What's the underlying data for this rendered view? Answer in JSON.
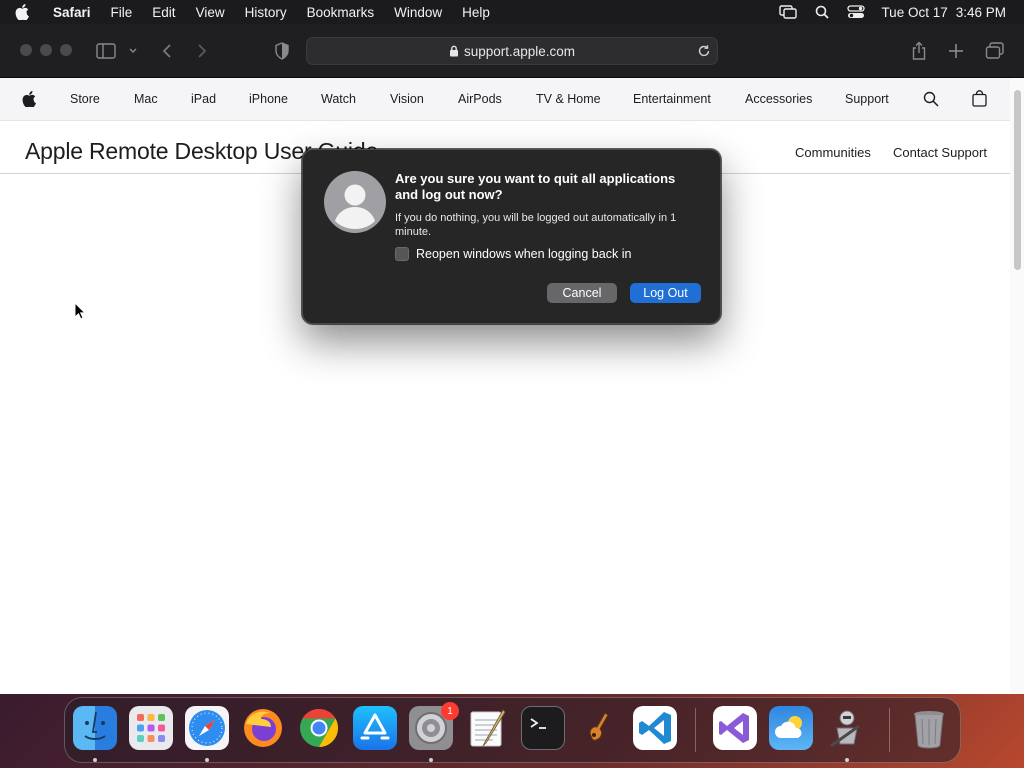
{
  "menubar": {
    "app_name": "Safari",
    "items": [
      "File",
      "Edit",
      "View",
      "History",
      "Bookmarks",
      "Window",
      "Help"
    ],
    "date": "Tue Oct 17",
    "time": "3:46 PM"
  },
  "browser": {
    "url": "support.apple.com"
  },
  "globalnav": {
    "items": [
      "Store",
      "Mac",
      "iPad",
      "iPhone",
      "Watch",
      "Vision",
      "AirPods",
      "TV & Home",
      "Entertainment",
      "Accessories",
      "Support"
    ]
  },
  "subheader": {
    "title": "Apple Remote Desktop User Guide",
    "links": [
      "Communities",
      "Contact Support"
    ]
  },
  "dialog": {
    "heading": "Are you sure you want to quit all applications and log out now?",
    "message": "If you do nothing, you will be logged out automatically in 1 minute.",
    "checkbox_label": "Reopen windows when logging back in",
    "cancel_label": "Cancel",
    "confirm_label": "Log Out"
  },
  "dock": {
    "settings_badge": "1"
  },
  "colors": {
    "accent": "#1f6fd6",
    "dialog_bg": "#262626",
    "menubar_bg": "#1b1b1d"
  }
}
